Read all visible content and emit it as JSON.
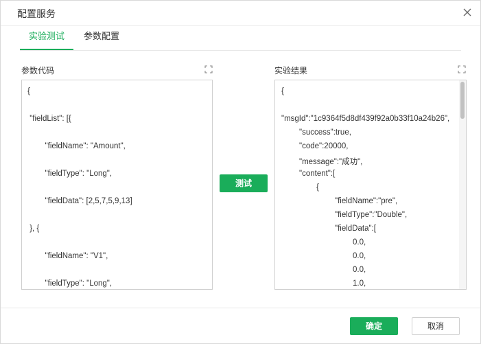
{
  "dialog": {
    "title": "配置服务",
    "close_icon": "close-icon"
  },
  "tabs": [
    {
      "label": "实验测试",
      "active": true
    },
    {
      "label": "参数配置",
      "active": false
    }
  ],
  "params_panel": {
    "label": "参数代码",
    "expand_icon": "fullscreen-icon",
    "lines": [
      "{",
      " \"fieldList\": [{",
      "        \"fieldName\": \"Amount\",",
      "        \"fieldType\": \"Long\",",
      "        \"fieldData\": [2,5,7,5,9,13]",
      " }, {",
      "        \"fieldName\": \"V1\",",
      "        \"fieldType\": \"Long\","
    ]
  },
  "test_button": {
    "label": "测试"
  },
  "result_panel": {
    "label": "实验结果",
    "expand_icon": "fullscreen-icon",
    "lines": [
      "{",
      "\"msgId\":\"1c9364f5d8df439f92a0b33f10a24b26\",",
      "\"success\":true,",
      "\"code\":20000,",
      "\"message\":\"成功\",",
      "\"content\":[",
      "{",
      "\"fieldName\":\"pre\",",
      "\"fieldType\":\"Double\",",
      "\"fieldData\":[",
      "0.0,",
      "0.0,",
      "0.0,",
      "1.0,"
    ]
  },
  "footer": {
    "ok_label": "确定",
    "cancel_label": "取消"
  },
  "colors": {
    "accent": "#1aad5a",
    "border": "#cfcfcf",
    "text": "#333333"
  }
}
